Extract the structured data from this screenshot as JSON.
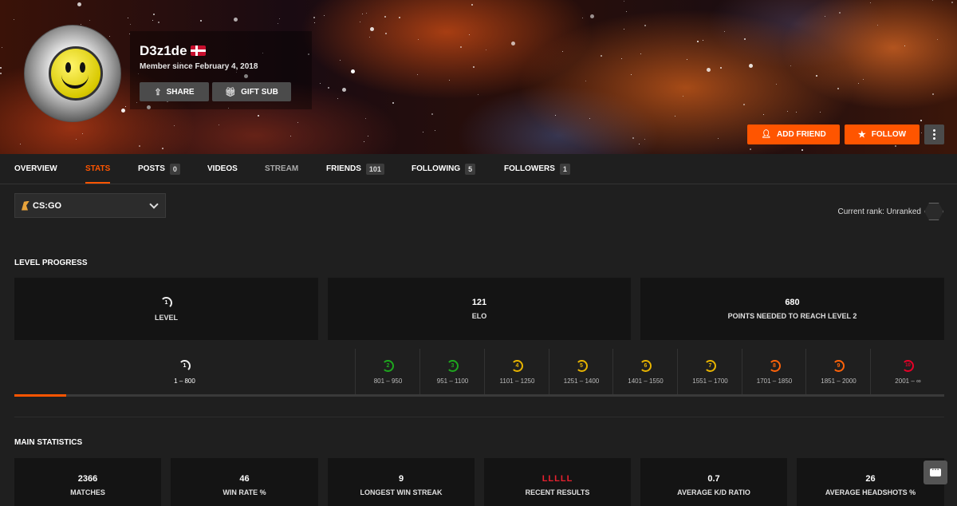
{
  "profile": {
    "username": "D3z1de",
    "member_since": "Member since February 4, 2018",
    "share_label": "SHARE",
    "gift_label": "GIFT SUB",
    "add_friend_label": "ADD FRIEND",
    "follow_label": "FOLLOW"
  },
  "tabs": [
    {
      "label": "OVERVIEW",
      "count": null
    },
    {
      "label": "STATS",
      "count": null
    },
    {
      "label": "POSTS",
      "count": "0"
    },
    {
      "label": "VIDEOS",
      "count": null
    },
    {
      "label": "STREAM",
      "count": null
    },
    {
      "label": "FRIENDS",
      "count": "101"
    },
    {
      "label": "FOLLOWING",
      "count": "5"
    },
    {
      "label": "FOLLOWERS",
      "count": "1"
    }
  ],
  "active_tab": "STATS",
  "game_select": {
    "value": "CS:GO"
  },
  "rank": {
    "label": "Current rank: Unranked"
  },
  "level_progress": {
    "title": "LEVEL PROGRESS",
    "cards": [
      {
        "value": "1",
        "label": "LEVEL"
      },
      {
        "value": "121",
        "label": "ELO"
      },
      {
        "value": "680",
        "label": "POINTS NEEDED TO REACH LEVEL 2"
      }
    ],
    "levels": [
      {
        "level": "1",
        "range": "1 – 800",
        "color": "#eeeeee"
      },
      {
        "level": "2",
        "range": "801 – 950",
        "color": "#1ea81e"
      },
      {
        "level": "3",
        "range": "951 – 1100",
        "color": "#1ea81e"
      },
      {
        "level": "4",
        "range": "1101 – 1250",
        "color": "#e8b400"
      },
      {
        "level": "5",
        "range": "1251 – 1400",
        "color": "#e8b400"
      },
      {
        "level": "6",
        "range": "1401 – 1550",
        "color": "#e8b400"
      },
      {
        "level": "7",
        "range": "1551 – 1700",
        "color": "#e8b400"
      },
      {
        "level": "8",
        "range": "1701 – 1850",
        "color": "#ff6309"
      },
      {
        "level": "9",
        "range": "1851 – 2000",
        "color": "#ff6309"
      },
      {
        "level": "10",
        "range": "2001 – ∞",
        "color": "#e80128"
      }
    ],
    "progress_fraction": 0.056
  },
  "main_statistics": {
    "title": "MAIN STATISTICS",
    "cards": [
      {
        "value": "2366",
        "label": "MATCHES"
      },
      {
        "value": "46",
        "label": "WIN RATE %"
      },
      {
        "value": "9",
        "label": "LONGEST WIN STREAK"
      },
      {
        "value": "LLLLL",
        "label": "RECENT RESULTS"
      },
      {
        "value": "0.7",
        "label": "AVERAGE K/D RATIO"
      },
      {
        "value": "26",
        "label": "AVERAGE HEADSHOTS %"
      }
    ]
  },
  "colors": {
    "accent": "#ff5500",
    "loss": "#e8212f"
  },
  "icons": [
    "share-icon",
    "gift-icon",
    "add-friend-icon",
    "star-icon",
    "more-icon",
    "chevron-down-icon",
    "chat-icon"
  ]
}
